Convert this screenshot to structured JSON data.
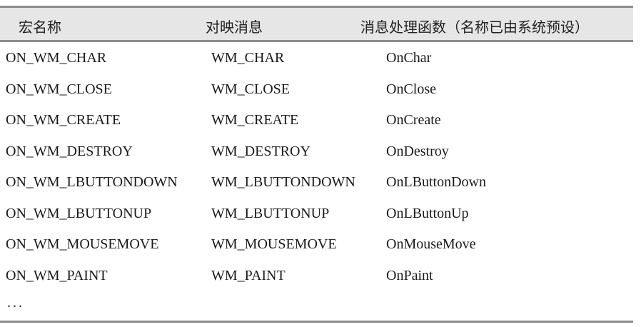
{
  "table": {
    "headers": [
      "宏名称",
      "对映消息",
      "消息处理函数（名称已由系统预设）"
    ],
    "rows": [
      [
        "ON_WM_CHAR",
        "WM_CHAR",
        "OnChar"
      ],
      [
        "ON_WM_CLOSE",
        "WM_CLOSE",
        "OnClose"
      ],
      [
        "ON_WM_CREATE",
        "WM_CREATE",
        "OnCreate"
      ],
      [
        "ON_WM_DESTROY",
        "WM_DESTROY",
        "OnDestroy"
      ],
      [
        "ON_WM_LBUTTONDOWN",
        "WM_LBUTTONDOWN",
        "OnLButtonDown"
      ],
      [
        "ON_WM_LBUTTONUP",
        "WM_LBUTTONUP",
        "OnLButtonUp"
      ],
      [
        "ON_WM_MOUSEMOVE",
        "WM_MOUSEMOVE",
        "OnMouseMove"
      ],
      [
        "ON_WM_PAINT",
        "WM_PAINT",
        "OnPaint"
      ]
    ],
    "ellipsis": "..."
  }
}
